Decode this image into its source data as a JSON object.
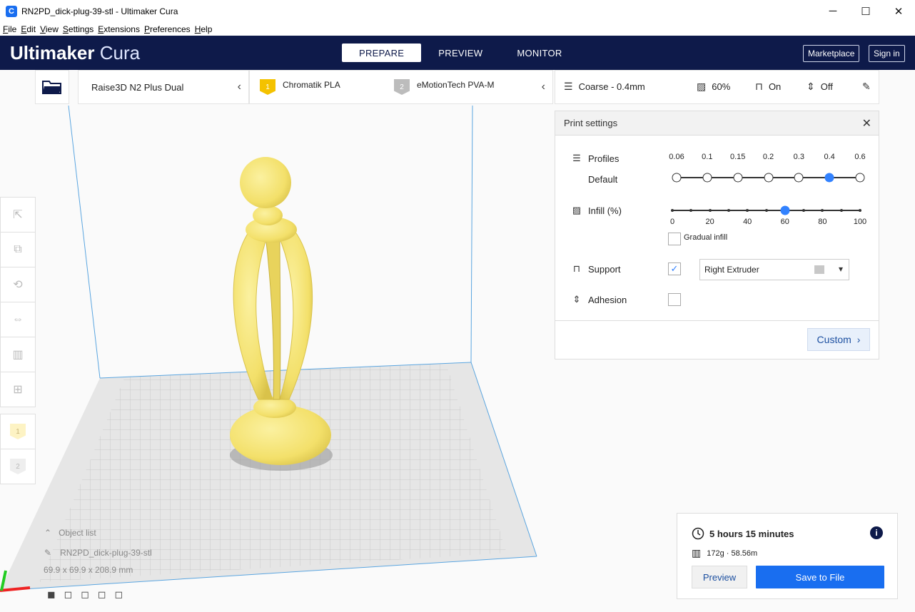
{
  "window": {
    "title": "RN2PD_dick-plug-39-stl - Ultimaker Cura",
    "app_icon_glyph": "C",
    "minimize": "─",
    "maximize": "☐",
    "close": "✕"
  },
  "menu": [
    "File",
    "Edit",
    "View",
    "Settings",
    "Extensions",
    "Preferences",
    "Help"
  ],
  "header": {
    "logo_bold": "Ultimaker",
    "logo_light": "Cura",
    "tabs": [
      {
        "label": "PREPARE",
        "active": true
      },
      {
        "label": "PREVIEW",
        "active": false
      },
      {
        "label": "MONITOR",
        "active": false
      }
    ],
    "marketplace": "Marketplace",
    "signin": "Sign in"
  },
  "toolbar": {
    "machine": "Raise3D N2 Plus Dual",
    "extruder1": {
      "num": "1",
      "material": "Chromatik PLA",
      "color": "#f4c200"
    },
    "extruder2": {
      "num": "2",
      "material": "eMotionTech PVA-M",
      "color": "#bcbcbc"
    },
    "profile": "Coarse - 0.4mm",
    "infill": "60%",
    "support": "On",
    "adhesion": "Off"
  },
  "print_settings": {
    "title": "Print settings",
    "profiles_label": "Profiles",
    "default_label": "Default",
    "profile_ticks": [
      "0.06",
      "0.1",
      "0.15",
      "0.2",
      "0.3",
      "0.4",
      "0.6"
    ],
    "profile_selected_index": 5,
    "infill_label": "Infill (%)",
    "infill_ticks": [
      "0",
      "20",
      "40",
      "60",
      "80",
      "100"
    ],
    "infill_value": 60,
    "gradual_infill_label": "Gradual infill",
    "gradual_checked": false,
    "support_label": "Support",
    "support_checked": true,
    "support_extruder": "Right Extruder",
    "adhesion_label": "Adhesion",
    "adhesion_checked": false,
    "custom_label": "Custom"
  },
  "object_list": {
    "header": "Object list",
    "object_name": "RN2PD_dick-plug-39-stl",
    "dimensions": "69.9 x 69.9 x 208.9 mm"
  },
  "summary": {
    "time": "5 hours 15 minutes",
    "material": "172g · 58.56m",
    "preview_label": "Preview",
    "save_label": "Save to File"
  },
  "colors": {
    "header_bg": "#0e1a4a",
    "accent": "#196ef0",
    "model": "#f6e777"
  }
}
